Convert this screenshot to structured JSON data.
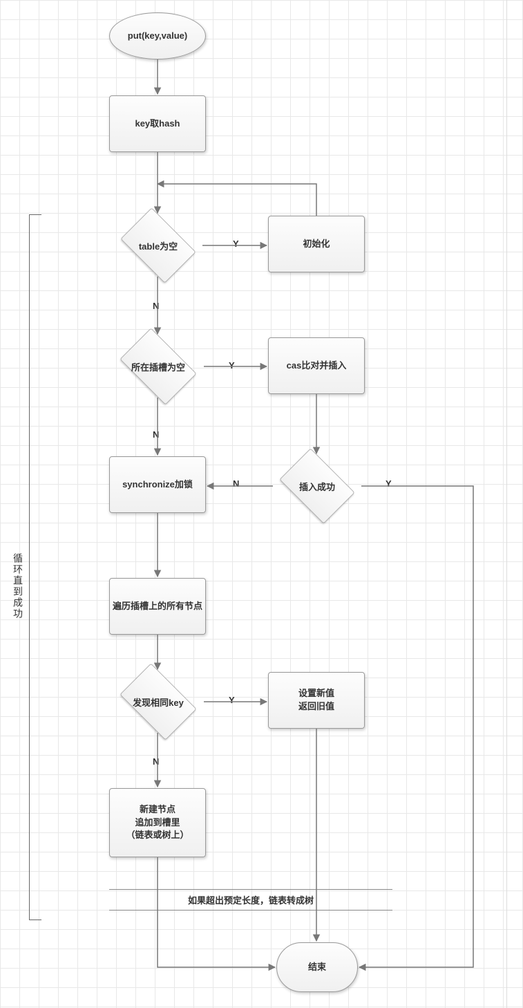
{
  "chart_data": {
    "type": "flowchart",
    "title": "",
    "nodes": {
      "start": {
        "shape": "ellipse",
        "label": "put(key,value)"
      },
      "hash": {
        "shape": "process",
        "label": "key取hash"
      },
      "tableEmpty": {
        "shape": "decision",
        "label": "table为空"
      },
      "init": {
        "shape": "process",
        "label": "初始化"
      },
      "slotEmpty": {
        "shape": "decision",
        "label": "所在插槽为空"
      },
      "cas": {
        "shape": "process",
        "label": "cas比对并插入"
      },
      "insertOk": {
        "shape": "decision",
        "label": "插入成功"
      },
      "sync": {
        "shape": "process",
        "label": "synchronize加锁"
      },
      "traverse": {
        "shape": "process",
        "label": "遍历插槽上的所有节点"
      },
      "sameKey": {
        "shape": "decision",
        "label": "发现相同key"
      },
      "setReturn": {
        "shape": "process",
        "label": "设置新值\n返回旧值"
      },
      "append": {
        "shape": "process",
        "label": "新建节点\n追加到槽里\n（链表或树上）"
      },
      "treeify": {
        "shape": "note",
        "label": "如果超出预定长度，链表转成树"
      },
      "end": {
        "shape": "terminator",
        "label": "结束"
      }
    },
    "edges": [
      {
        "from": "start",
        "to": "hash"
      },
      {
        "from": "hash",
        "to": "tableEmpty"
      },
      {
        "from": "tableEmpty",
        "to": "init",
        "label": "Y"
      },
      {
        "from": "tableEmpty",
        "to": "slotEmpty",
        "label": "N"
      },
      {
        "from": "init",
        "to": "tableEmpty"
      },
      {
        "from": "slotEmpty",
        "to": "cas",
        "label": "Y"
      },
      {
        "from": "slotEmpty",
        "to": "sync",
        "label": "N"
      },
      {
        "from": "cas",
        "to": "insertOk"
      },
      {
        "from": "insertOk",
        "to": "sync",
        "label": "N"
      },
      {
        "from": "insertOk",
        "to": "end",
        "label": "Y"
      },
      {
        "from": "sync",
        "to": "traverse"
      },
      {
        "from": "traverse",
        "to": "sameKey"
      },
      {
        "from": "sameKey",
        "to": "setReturn",
        "label": "Y"
      },
      {
        "from": "sameKey",
        "to": "append",
        "label": "N"
      },
      {
        "from": "setReturn",
        "to": "end"
      },
      {
        "from": "append",
        "to": "treeify"
      },
      {
        "from": "treeify",
        "to": "end"
      }
    ],
    "annotations": {
      "loop_caption": "循环直到成功",
      "edge_labels": {
        "yes": "Y",
        "no": "N"
      }
    }
  }
}
